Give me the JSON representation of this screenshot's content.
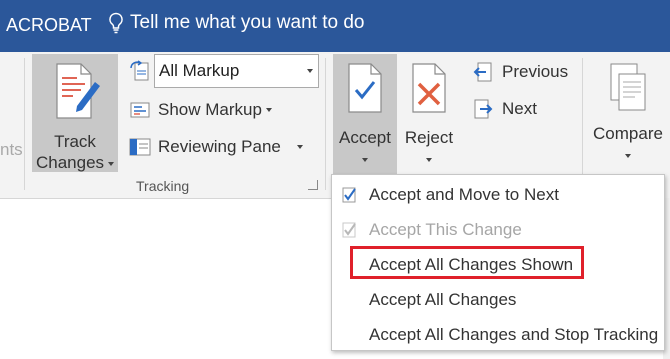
{
  "titlebar": {
    "tab": "ACROBAT",
    "tell_me": "Tell me what you want to do",
    "tell_me_icon": "lightbulb-icon"
  },
  "ribbon": {
    "left_ghost": "nts",
    "track_changes": {
      "line1": "Track",
      "line2": "Changes"
    },
    "markup_select": {
      "value": "All Markup"
    },
    "show_markup": "Show Markup",
    "reviewing_pane": "Reviewing Pane",
    "tracking_group": "Tracking",
    "accept": "Accept",
    "reject": "Reject",
    "previous": "Previous",
    "next": "Next",
    "compare": "Compare"
  },
  "accept_menu": {
    "items": [
      {
        "label": "Accept and Move to Next",
        "enabled": true,
        "icon": "accept-check-icon"
      },
      {
        "label": "Accept This Change",
        "enabled": false,
        "icon": "accept-check-icon"
      },
      {
        "label": "Accept All Changes Shown",
        "enabled": true,
        "highlighted": true
      },
      {
        "label": "Accept All Changes",
        "enabled": true
      },
      {
        "label": "Accept All Changes and Stop Tracking",
        "enabled": true
      }
    ]
  },
  "colors": {
    "titlebar": "#2b579a",
    "ribbon": "#f3f3f3",
    "highlight": "#e0202a",
    "selected_button": "#c8c8c8"
  }
}
